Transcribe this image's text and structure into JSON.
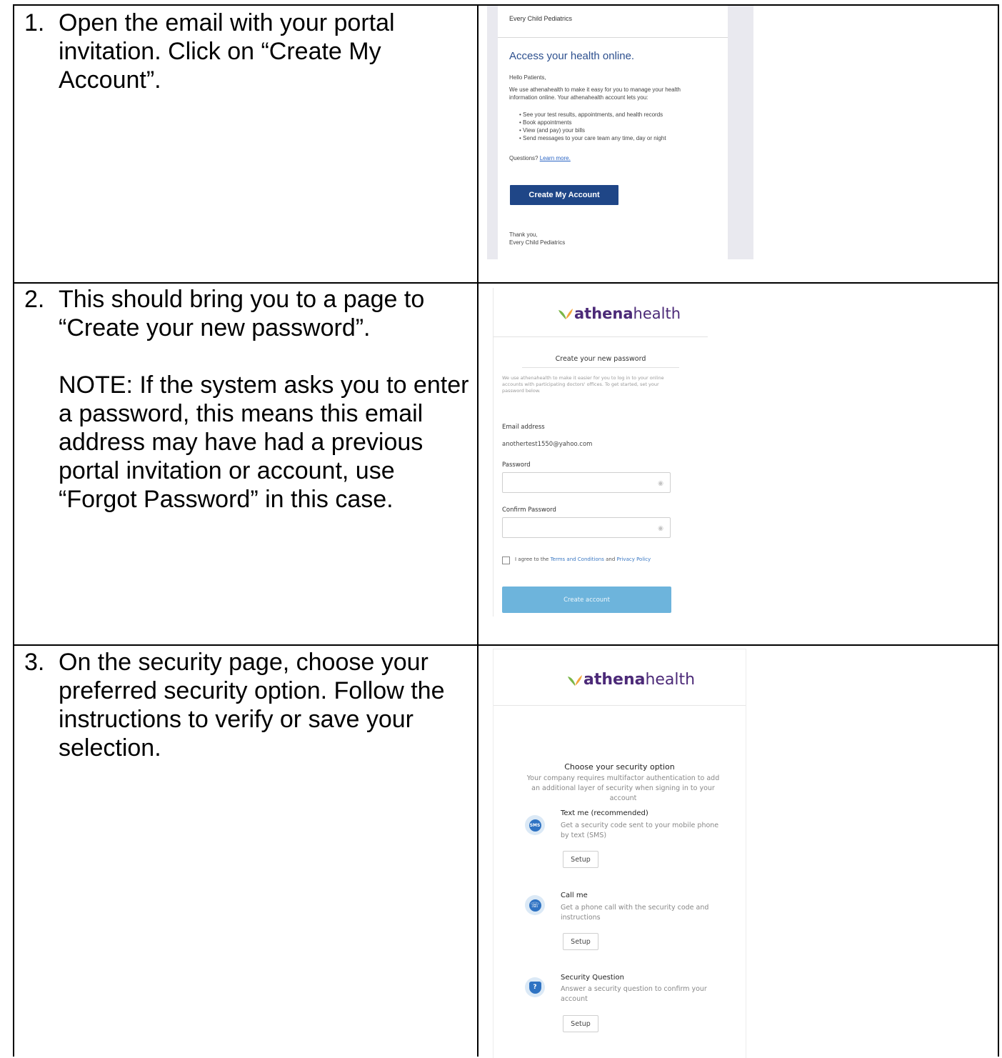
{
  "steps": [
    {
      "number": "1.",
      "paragraphs": [
        "Open the email with your portal invitation. Click on “Create My Account”."
      ]
    },
    {
      "number": "2.",
      "paragraphs": [
        "This should bring you to a page to “Create your new password”.",
        "NOTE: If the system asks you to enter a password, this means this email address may have had a previous portal invitation or account, use “Forgot Password” in this case."
      ]
    },
    {
      "number": "3.",
      "paragraphs": [
        "On the security page, choose your preferred security option. Follow the instructions to verify or save your selection."
      ]
    }
  ],
  "email": {
    "sender": "Every Child Pediatrics",
    "heading": "Access your health online.",
    "greeting": "Hello Patients,",
    "intro": "We use athenahealth to make it easy for you to manage your health information online. Your athenahealth account lets you:",
    "bullets": [
      "See your test results, appointments, and health records",
      "Book appointments",
      "View (and pay) your bills",
      "Send messages to your care team any time, day or night"
    ],
    "questions_label": "Questions?",
    "learn_more": "Learn more.",
    "cta": "Create My Account",
    "thanks": "Thank you,",
    "signature": "Every Child Pediatrics"
  },
  "logo": {
    "part1": "athena",
    "part2": "health"
  },
  "password_page": {
    "title": "Create your new password",
    "intro": "We use athenahealth to make it easier for you to log in to your online accounts with participating doctors' offices. To get started, set your password below.",
    "email_label": "Email address",
    "email_value": "anothertest1550@yahoo.com",
    "password_label": "Password",
    "confirm_label": "Confirm Password",
    "agree_prefix": "I agree to the",
    "terms_link": "Terms and Conditions",
    "and": "and",
    "privacy_link": "Privacy Policy",
    "submit": "Create account"
  },
  "security_page": {
    "title": "Choose your security option",
    "subtitle": "Your company requires multifactor authentication to add an additional layer of security when signing in to your account",
    "options": [
      {
        "title": "Text me (recommended)",
        "desc": "Get a security code sent to your mobile phone by text (SMS)",
        "button": "Setup",
        "icon": "sms-icon",
        "icon_text": "SMS"
      },
      {
        "title": "Call me",
        "desc": "Get a phone call with the security code and instructions",
        "button": "Setup",
        "icon": "phone-icon",
        "icon_text": "☏"
      },
      {
        "title": "Security Question",
        "desc": "Answer a security question to confirm your account",
        "button": "Setup",
        "icon": "shield-icon",
        "icon_text": "?"
      }
    ]
  },
  "colors": {
    "email_button": "#1f4687",
    "email_heading": "#2c4f8e",
    "brand_purple": "#4c2a78",
    "create_account_button": "#6db4dc",
    "option_icon": "#2f73c3"
  }
}
